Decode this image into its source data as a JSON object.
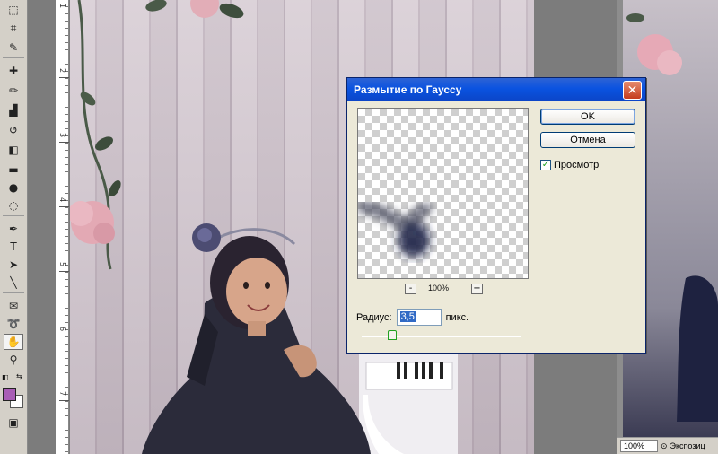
{
  "toolbox": {
    "tools": [
      "marquee-tool",
      "crop-tool",
      "eyedropper-tool",
      "healing-brush-tool",
      "brush-tool",
      "clone-stamp-tool",
      "history-brush-tool",
      "eraser-tool",
      "gradient-tool",
      "blur-tool",
      "dodge-tool",
      "pen-tool",
      "type-tool",
      "path-selection-tool",
      "line-tool",
      "notes-tool",
      "lasso-tool",
      "hand-tool",
      "zoom-tool"
    ],
    "active_tool": "hand-tool",
    "foreground_color": "#a85db5",
    "background_color": "#ffffff"
  },
  "ruler": {
    "labels": [
      "1",
      "2",
      "3",
      "4",
      "5",
      "6",
      "7"
    ]
  },
  "dialog": {
    "title": "Размытие по Гауссу",
    "ok_label": "OK",
    "cancel_label": "Отмена",
    "preview_label": "Просмотр",
    "preview_checked": true,
    "zoom_out_label": "-",
    "zoom_in_label": "+",
    "zoom_percent": "100%",
    "radius_label": "Радиус:",
    "radius_value": "3,5",
    "radius_unit": "пикс.",
    "close_label": "✕"
  },
  "status": {
    "zoom": "100%",
    "info": "Экспозиц"
  },
  "colors": {
    "titlebar": "#0a53e0",
    "dialog_bg": "#ece9d8"
  }
}
